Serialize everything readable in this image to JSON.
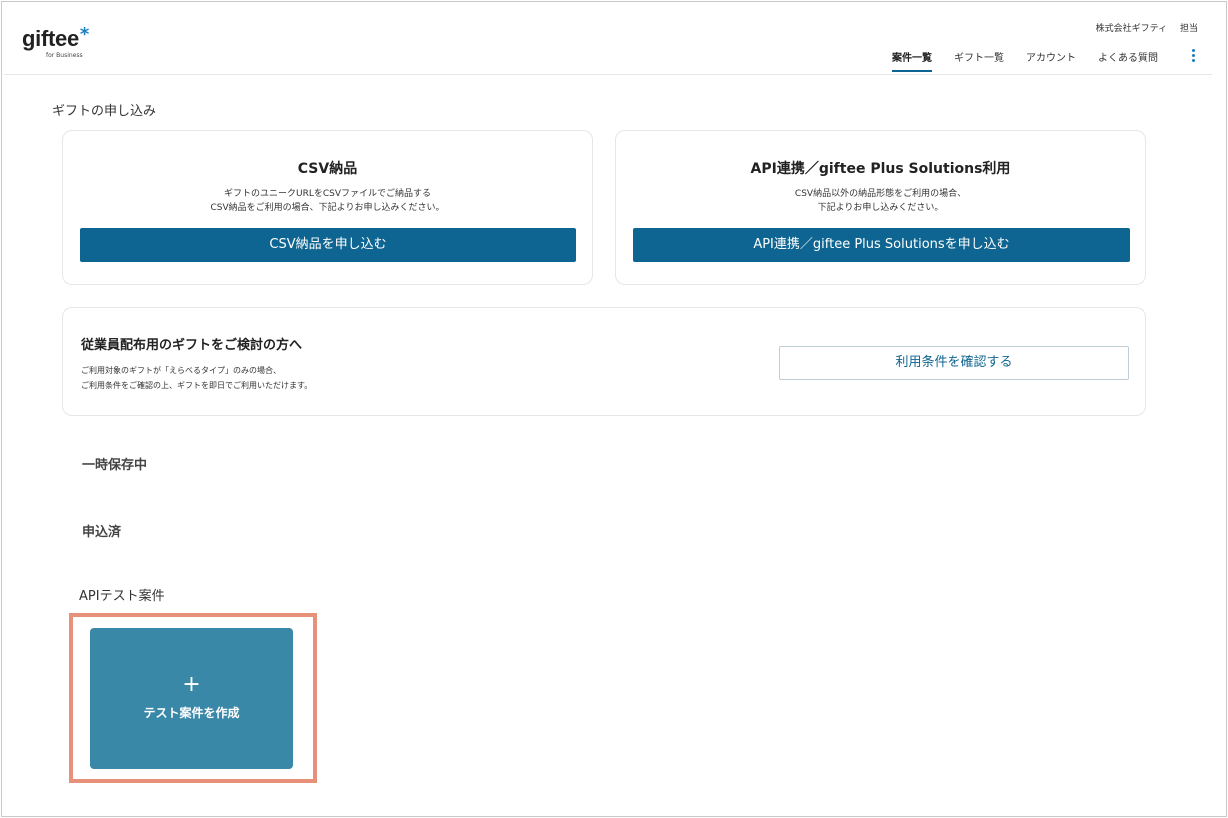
{
  "header": {
    "logo_text": "giftee",
    "logo_star": "*",
    "logo_sub": "for Business",
    "company": "株式会社ギフティ",
    "role": "担当",
    "nav": [
      "案件一覧",
      "ギフト一覧",
      "アカウント",
      "よくある質問"
    ],
    "menu_icon": "kebab-menu-icon",
    "accent": "#0f6591"
  },
  "page": {
    "title": "ギフトの申し込み"
  },
  "csv_card": {
    "title": "CSV納品",
    "desc_line1": "ギフトのユニークURLをCSVファイルでご納品する",
    "desc_line2": "CSV納品をご利用の場合、下記よりお申し込みください。",
    "button": "CSV納品を申し込む"
  },
  "api_card": {
    "title": "API連携／giftee Plus Solutions利用",
    "desc_line1": "CSV納品以外の納品形態をご利用の場合、",
    "desc_line2": "下記よりお申し込みください。",
    "button": "API連携／giftee Plus Solutionsを申し込む"
  },
  "employee_card": {
    "title": "従業員配布用のギフトをご検討の方へ",
    "desc_line1": "ご利用対象のギフトが「えらべるタイプ」のみの場合、",
    "desc_line2": "ご利用条件をご確認の上、ギフトを即日でご利用いただけます。",
    "button": "利用条件を確認する"
  },
  "sections": {
    "draft": "一時保存中",
    "applied": "申込済",
    "api_test": "APIテスト案件"
  },
  "create_tile": {
    "icon": "+",
    "label": "テスト案件を作成",
    "highlight_color": "#e8917a",
    "tile_color": "#3a88a8"
  }
}
